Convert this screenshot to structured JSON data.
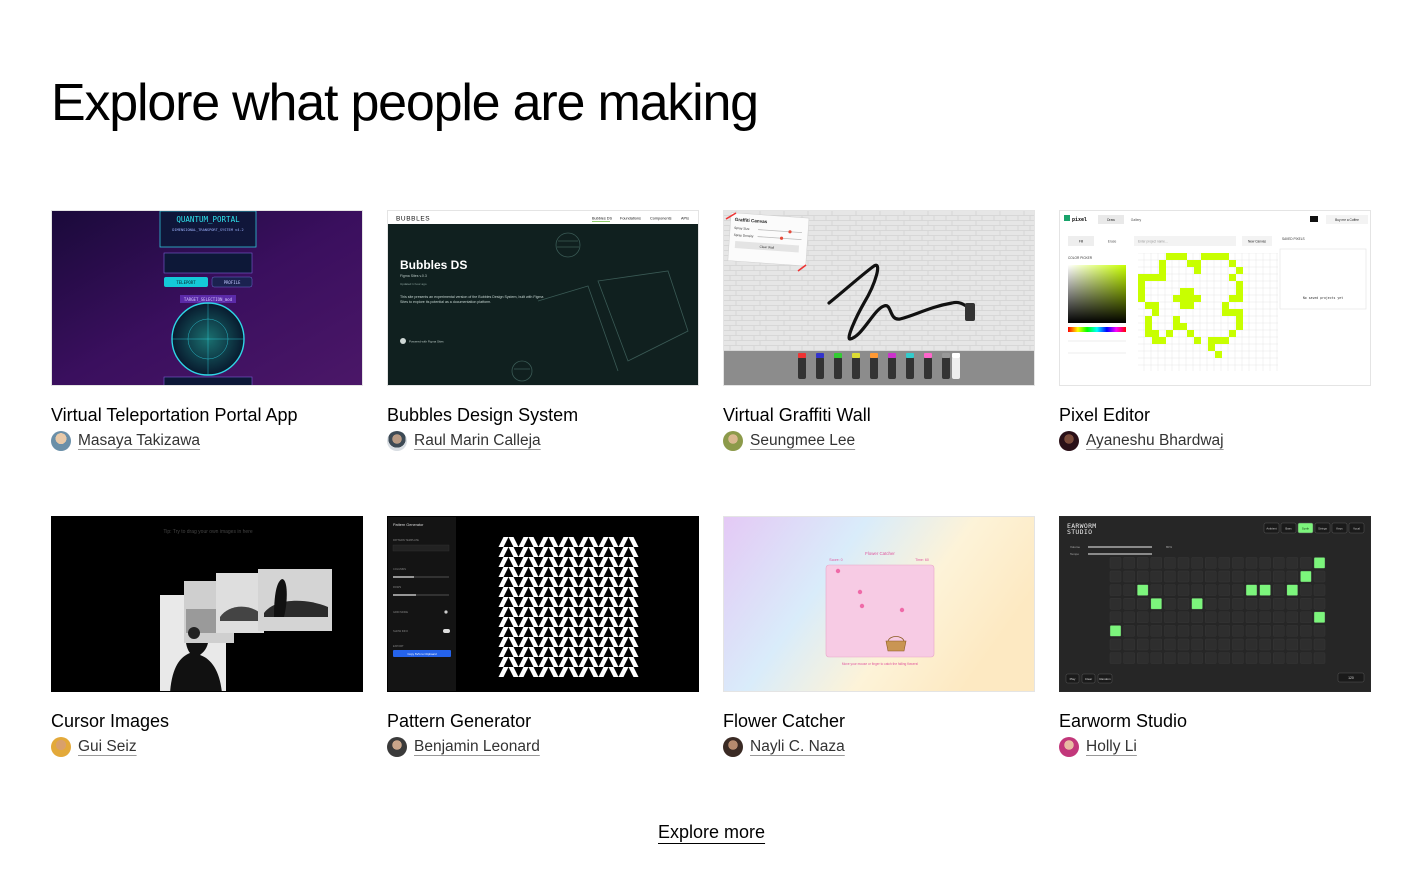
{
  "section": {
    "title": "Explore what people are making",
    "explore_more": "Explore more"
  },
  "cards": [
    {
      "title": "Virtual Teleportation Portal App",
      "author": "Masaya Takizawa",
      "thumb_text": {
        "heading": "QUANTUM_PORTAL",
        "sub": "DIMENSIONAL_TRANSPORT_SYSTEM v4.2",
        "target": "TARGET_SELECTION_mod",
        "btn1": "TELEPORT",
        "btn2": "PROFILE"
      }
    },
    {
      "title": "Bubbles Design System",
      "author": "Raul Marin Calleja",
      "thumb_text": {
        "brand": "BUBBLES",
        "nav": [
          "Bubbles DS",
          "Foundations",
          "Components",
          "APIs"
        ],
        "heading": "Bubbles DS",
        "sub": "Figma Sites v.0.3",
        "meta": "Updated 1 hour ago",
        "body": "This site presents an experimental version of the Bubbles Design System, built with Figma Sites to explore its potential as a documentation platform.",
        "credit": "Powered with Figma Sites"
      }
    },
    {
      "title": "Virtual Graffiti Wall",
      "author": "Seungmee Lee",
      "thumb_text": {
        "panel_title": "Graffiti Canvas",
        "spray_size": "Spray Size",
        "spray_density": "Spray Density",
        "clear": "Clear Wall"
      }
    },
    {
      "title": "Pixel Editor",
      "author": "Ayaneshu Bhardwaj",
      "thumb_text": {
        "brand": "pixel",
        "tabs": [
          "Draw",
          "Gallery"
        ],
        "tools": [
          "Fill",
          "Erase"
        ],
        "placeholder": "Enter project name...",
        "new_canvas": "New Canvas",
        "color_picker": "COLOR PICKER",
        "saved_title": "SAVED PIXELS",
        "saved_empty": "No saved projects yet",
        "coffee": "Buy me a Coffee"
      }
    },
    {
      "title": "Cursor Images",
      "author": "Gui Seiz",
      "thumb_text": {
        "hint": "Tip: Try to drag your own images in here"
      }
    },
    {
      "title": "Pattern Generator",
      "author": "Benjamin Leonard",
      "thumb_text": {
        "panel_title": "Pattern Generator",
        "template": "PATTERN TEMPLATE",
        "columns": "COLUMNS",
        "rows": "ROWS",
        "grid_mode": "GRID MODE",
        "show_info": "SHOW INFO",
        "export": "EXPORT",
        "copy": "Copy SVG to Clipboard"
      }
    },
    {
      "title": "Flower Catcher",
      "author": "Nayli C. Naza",
      "thumb_text": {
        "heading": "Flower Catcher",
        "score": "Score: 0",
        "time": "Time: 60",
        "hint": "Move your mouse or finger to catch the falling flowers!"
      }
    },
    {
      "title": "Earworm Studio",
      "author": "Holly Li",
      "thumb_text": {
        "brand_line1": "EARWORM",
        "brand_line2": "STUDIO",
        "instruments": [
          "Ambient",
          "Bass",
          "Synth",
          "Strings",
          "Keys",
          "Vocal"
        ],
        "volume": "Volume",
        "volume_value": "80%",
        "tempo": "Tempo",
        "play": "Play",
        "clear": "Clear",
        "random": "Random",
        "bpm": "120"
      }
    }
  ],
  "colors": {
    "portal_bg": "#2a0c45",
    "bubbles_bg": "#10201f",
    "pixel_lime": "#c8ff00",
    "earworm_green": "#7cf57c",
    "flower_pink": "#f7cbe4"
  }
}
